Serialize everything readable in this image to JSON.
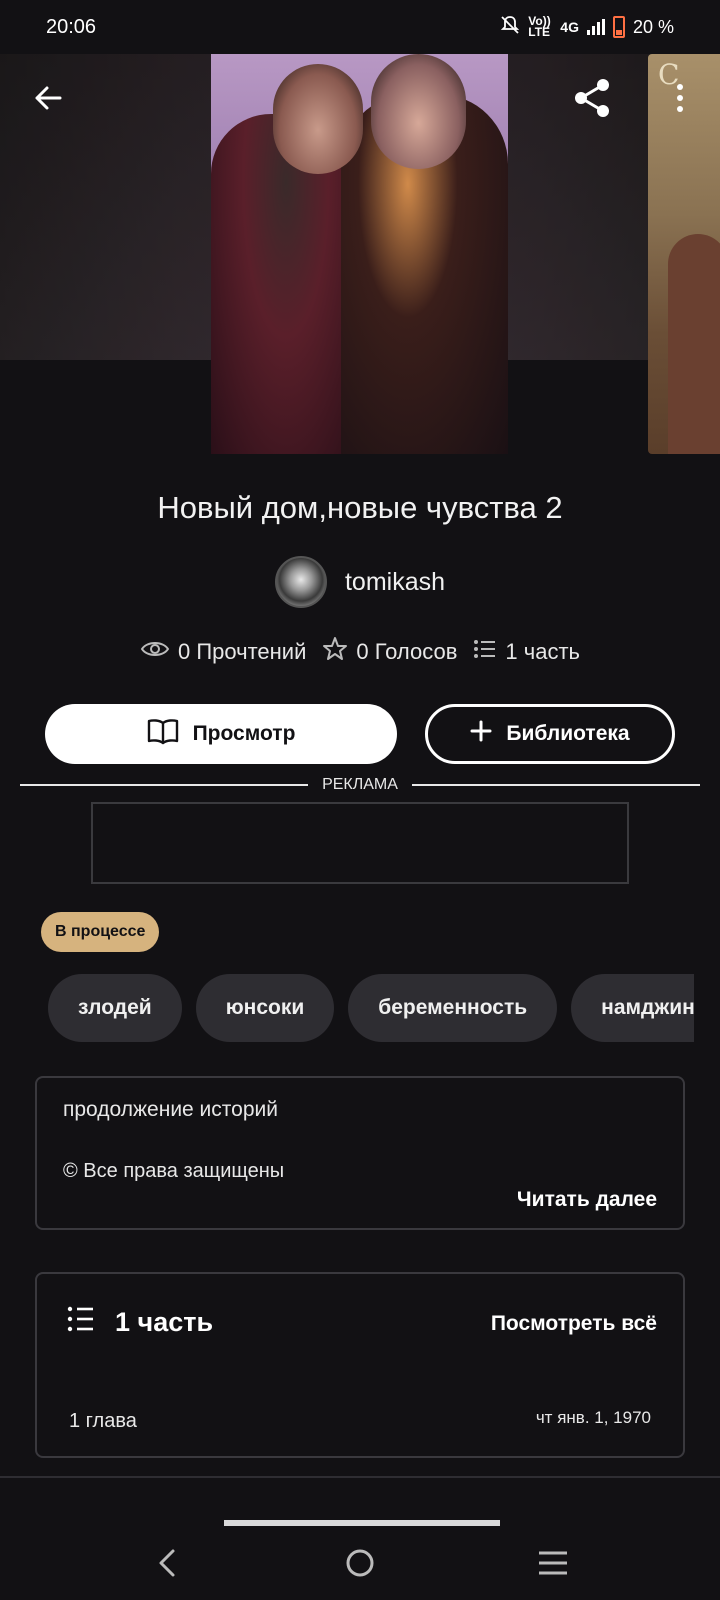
{
  "status_bar": {
    "time": "20:06",
    "network_volte": "Vo)) LTE",
    "network_type": "4G",
    "battery": "20 %"
  },
  "header": {
    "back_icon": "arrow-left-icon",
    "share_icon": "share-icon",
    "more_icon": "more-vertical-icon"
  },
  "story": {
    "title": "Новый дом,новые чувства 2",
    "author": "tomikash",
    "stats": {
      "reads": "0 Прочтений",
      "votes": "0 Голосов",
      "parts": "1 часть"
    }
  },
  "actions": {
    "view_label": "Просмотр",
    "library_label": "Библиотека"
  },
  "ad": {
    "label": "РЕКЛАМА"
  },
  "status_badge": "В процессе",
  "tags": [
    "злодей",
    "юнсоки",
    "беременность",
    "намджины"
  ],
  "description": {
    "text": "продолжение историй",
    "copyright": "© Все права защищены",
    "read_more": "Читать далее"
  },
  "parts_section": {
    "title": "1 часть",
    "see_all": "Посмотреть всё",
    "chapters": [
      {
        "name": "1 глава",
        "date": "чт янв. 1, 1970"
      }
    ]
  },
  "colors": {
    "background": "#121114",
    "badge": "#d6b37e",
    "tag_bg": "#2e2d32",
    "card_border": "#3a393e"
  }
}
